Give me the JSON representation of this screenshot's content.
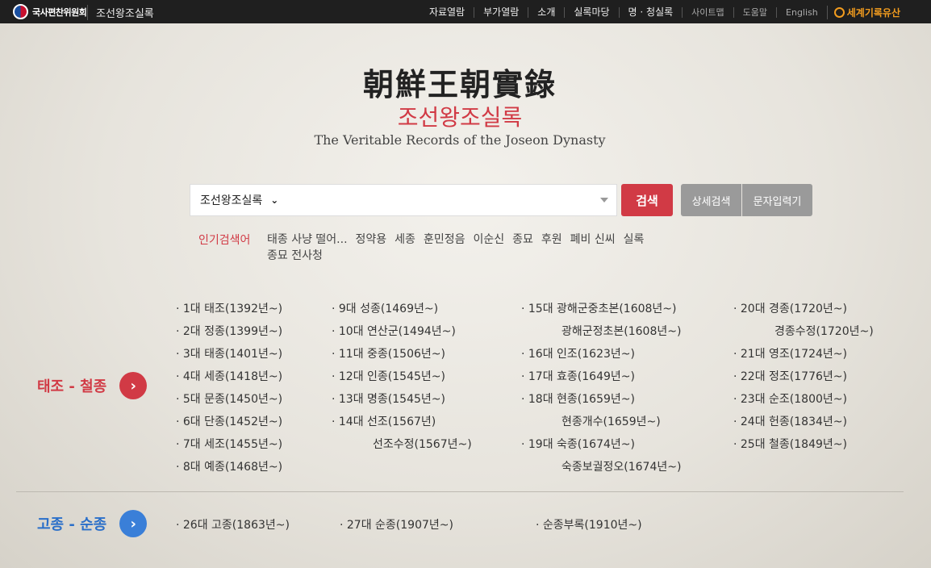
{
  "topbar": {
    "logo_text": "국사편찬위원회",
    "site_title": "조선왕조실록",
    "nav": [
      "자료열람",
      "부가열람",
      "소개",
      "실록마당",
      "명 · 청실록"
    ],
    "nav_secondary": [
      "사이트맵",
      "도움말",
      "English"
    ],
    "world_heritage": "세계기록유산"
  },
  "header": {
    "title_hanja": "朝鮮王朝實錄",
    "title_ko": "조선왕조실록",
    "title_en": "The Veritable Records of the Joseon Dynasty"
  },
  "search": {
    "scope": "조선왕조실록",
    "query": "",
    "search_button": "검색",
    "advanced_button": "상세검색",
    "char_input_button": "문자입력기"
  },
  "popular": {
    "label": "인기검색어",
    "terms": [
      "태종 사냥 떨어...",
      "정약용",
      "세종",
      "훈민정음",
      "이순신",
      "종묘",
      "후원",
      "폐비 신씨",
      "실록",
      "종묘 전사청"
    ]
  },
  "sections": {
    "first": {
      "label": "태조 - 철종",
      "col1": [
        "· 1대 태조(1392년~)",
        "· 2대 정종(1399년~)",
        "· 3대 태종(1401년~)",
        "· 4대 세종(1418년~)",
        "· 5대 문종(1450년~)",
        "· 6대 단종(1452년~)",
        "· 7대 세조(1455년~)",
        "· 8대 예종(1468년~)"
      ],
      "col2": [
        "· 9대 성종(1469년~)",
        "· 10대 연산군(1494년~)",
        "· 11대 중종(1506년~)",
        "· 12대 인종(1545년~)",
        "· 13대 명종(1545년~)",
        "· 14대 선조(1567년)"
      ],
      "col2_sub": "선조수정(1567년~)",
      "col3": [
        "· 15대 광해군중초본(1608년~)",
        "광해군정초본(1608년~)",
        "· 16대 인조(1623년~)",
        "· 17대 효종(1649년~)",
        "· 18대 현종(1659년~)",
        "현종개수(1659년~)",
        "· 19대 숙종(1674년~)",
        "숙종보궐정오(1674년~)"
      ],
      "col4": [
        "· 20대 경종(1720년~)",
        "경종수정(1720년~)",
        "· 21대 영조(1724년~)",
        "· 22대 정조(1776년~)",
        "· 23대 순조(1800년~)",
        "· 24대 헌종(1834년~)",
        "· 25대 철종(1849년~)"
      ]
    },
    "second": {
      "label": "고종 - 순종",
      "items": [
        "· 26대 고종(1863년~)",
        "· 27대 순종(1907년~)",
        "· 순종부록(1910년~)"
      ]
    }
  },
  "colors": {
    "accent_red": "#d13a45",
    "accent_blue": "#3a7fd8",
    "topbar": "#1f1f1f",
    "heritage": "#f29c1f"
  }
}
